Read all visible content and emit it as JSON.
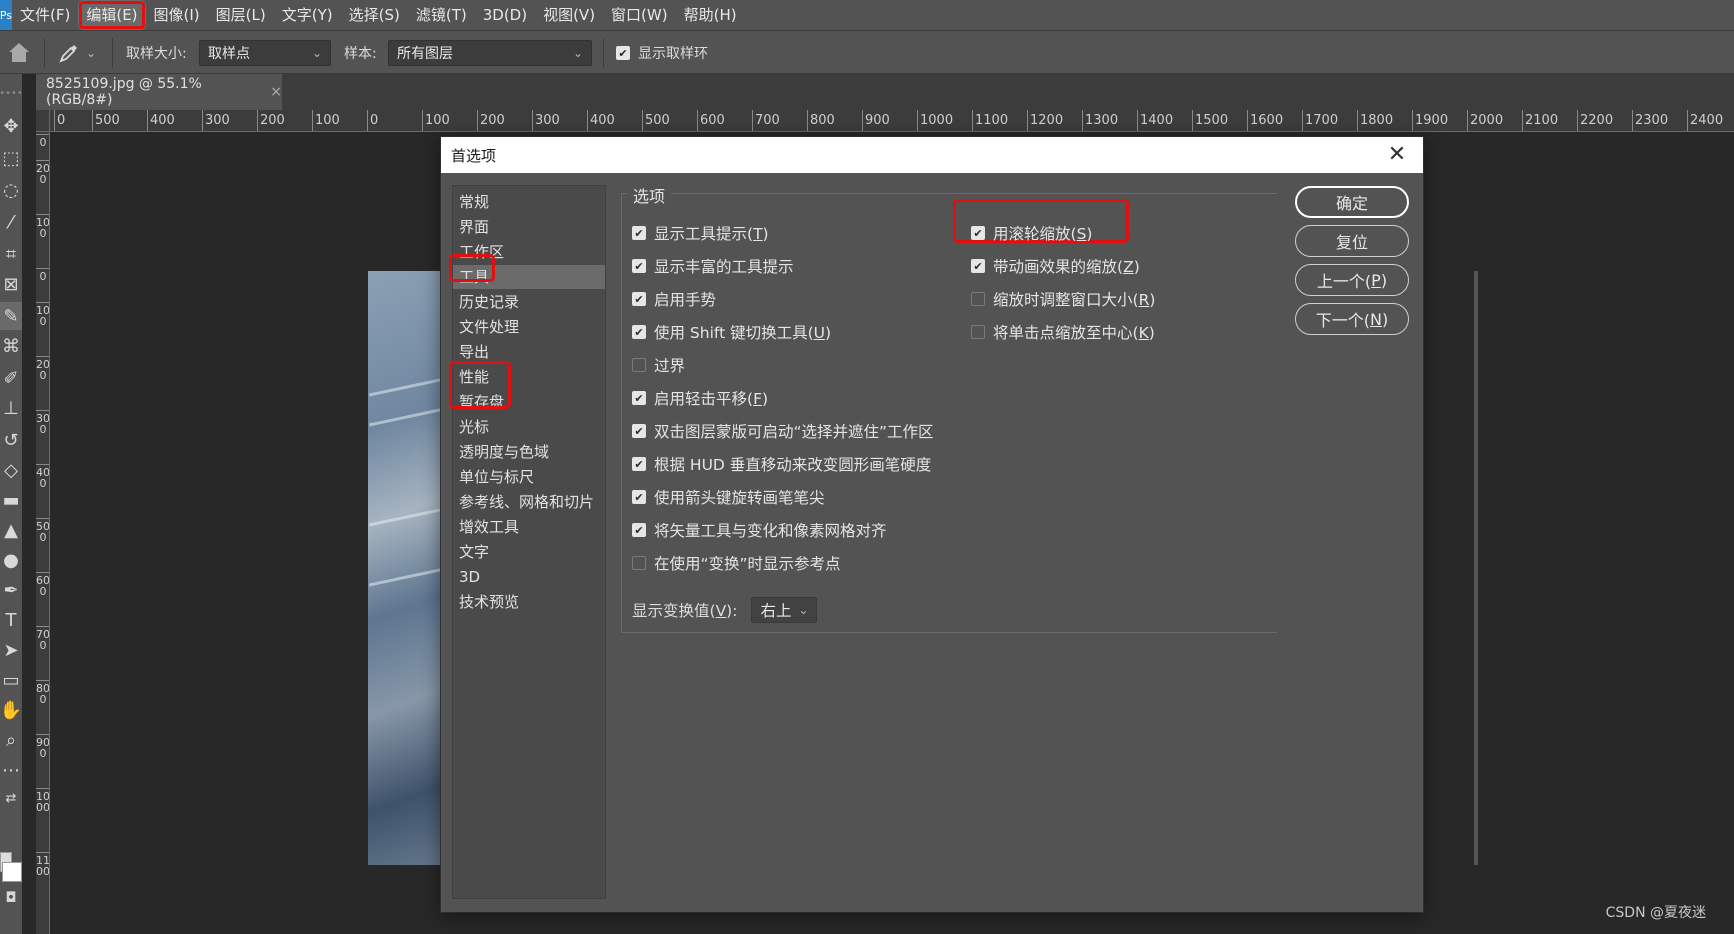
{
  "menubar": {
    "app_icon": "Ps",
    "items": [
      "文件(F)",
      "编辑(E)",
      "图像(I)",
      "图层(L)",
      "文字(Y)",
      "选择(S)",
      "滤镜(T)",
      "3D(D)",
      "视图(V)",
      "窗口(W)",
      "帮助(H)"
    ],
    "highlighted_item": "编辑(E)"
  },
  "optionsbar": {
    "home_icon": "home-icon",
    "tool_icon": "eyedropper-icon",
    "sample_size_label": "取样大小:",
    "sample_size_value": "取样点",
    "sample_label": "样本:",
    "sample_value": "所有图层",
    "show_ring_label": "显示取样环",
    "show_ring_checked": true
  },
  "document_tab": {
    "title": "8525109.jpg @ 55.1%(RGB/8#)",
    "close": "×"
  },
  "ruler_h": [
    "0",
    "500",
    "400",
    "300",
    "200",
    "100",
    "0",
    "100",
    "200",
    "300",
    "400",
    "500",
    "600",
    "700",
    "800",
    "900",
    "1000",
    "1100",
    "1200",
    "1300",
    "1400",
    "1500",
    "1600",
    "1700",
    "1800",
    "1900",
    "2000",
    "2100",
    "2200",
    "2300",
    "2400"
  ],
  "ruler_v": [
    "0",
    "200",
    "100",
    "0",
    "100",
    "200",
    "300",
    "400",
    "500",
    "600",
    "700",
    "800",
    "900",
    "1000",
    "1100"
  ],
  "toolbar_icons": [
    "move-icon",
    "marquee-icon",
    "lasso-icon",
    "magic-wand-icon",
    "crop-icon",
    "frame-icon",
    "eyedropper-icon",
    "healing-icon",
    "brush-icon",
    "stamp-icon",
    "history-brush-icon",
    "eraser-icon",
    "gradient-icon",
    "blur-icon",
    "dodge-icon",
    "pen-icon",
    "type-icon",
    "path-select-icon",
    "rectangle-icon",
    "hand-icon",
    "zoom-icon",
    "more-icon",
    "swap-colors-icon",
    "quick-mask-icon"
  ],
  "dialog": {
    "title": "首选项",
    "close": "✕",
    "categories": [
      "常规",
      "界面",
      "工作区",
      "工具",
      "历史记录",
      "文件处理",
      "导出",
      "性能",
      "暂存盘",
      "光标",
      "透明度与色域",
      "单位与标尺",
      "参考线、网格和切片",
      "增效工具",
      "文字",
      "3D",
      "技术预览"
    ],
    "selected_category": "工具",
    "group_title": "选项",
    "left_options": [
      {
        "pre": "显示工具提示(",
        "key": "T",
        "post": ")",
        "checked": true
      },
      {
        "pre": "显示丰富的工具提示",
        "key": "",
        "post": "",
        "checked": true
      },
      {
        "pre": "启用手势",
        "key": "",
        "post": "",
        "checked": true
      },
      {
        "pre": "使用 Shift 键切换工具(",
        "key": "U",
        "post": ")",
        "checked": true
      },
      {
        "pre": "过界",
        "key": "",
        "post": "",
        "checked": false
      },
      {
        "pre": "启用轻击平移(",
        "key": "F",
        "post": ")",
        "checked": true
      },
      {
        "pre": "双击图层蒙版可启动“选择并遮住”工作区",
        "key": "",
        "post": "",
        "checked": true
      },
      {
        "pre": "根据 HUD 垂直移动来改变圆形画笔硬度",
        "key": "",
        "post": "",
        "checked": true
      },
      {
        "pre": "使用箭头键旋转画笔笔尖",
        "key": "",
        "post": "",
        "checked": true
      },
      {
        "pre": "将矢量工具与变化和像素网格对齐",
        "key": "",
        "post": "",
        "checked": true
      },
      {
        "pre": "在使用“变换”时显示参考点",
        "key": "",
        "post": "",
        "checked": false
      }
    ],
    "right_options": [
      {
        "pre": "用滚轮缩放(",
        "key": "S",
        "post": ")",
        "checked": true
      },
      {
        "pre": "带动画效果的缩放(",
        "key": "Z",
        "post": ")",
        "checked": true
      },
      {
        "pre": "缩放时调整窗口大小(",
        "key": "R",
        "post": ")",
        "checked": false
      },
      {
        "pre": "将单击点缩放至中心(",
        "key": "K",
        "post": ")",
        "checked": false
      }
    ],
    "transform_label_pre": "显示变换值(",
    "transform_label_key": "V",
    "transform_label_post": "):",
    "transform_value": "右上",
    "buttons": {
      "ok": "确定",
      "reset": "复位",
      "prev_pre": "上一个(",
      "prev_key": "P",
      "next_pre": "下一个(",
      "next_key": "N",
      "close_paren": ")"
    }
  },
  "watermark": "CSDN @夏夜迷",
  "colors": {
    "highlight_red": "#e01010",
    "panel": "#535353",
    "canvas": "#282828"
  }
}
